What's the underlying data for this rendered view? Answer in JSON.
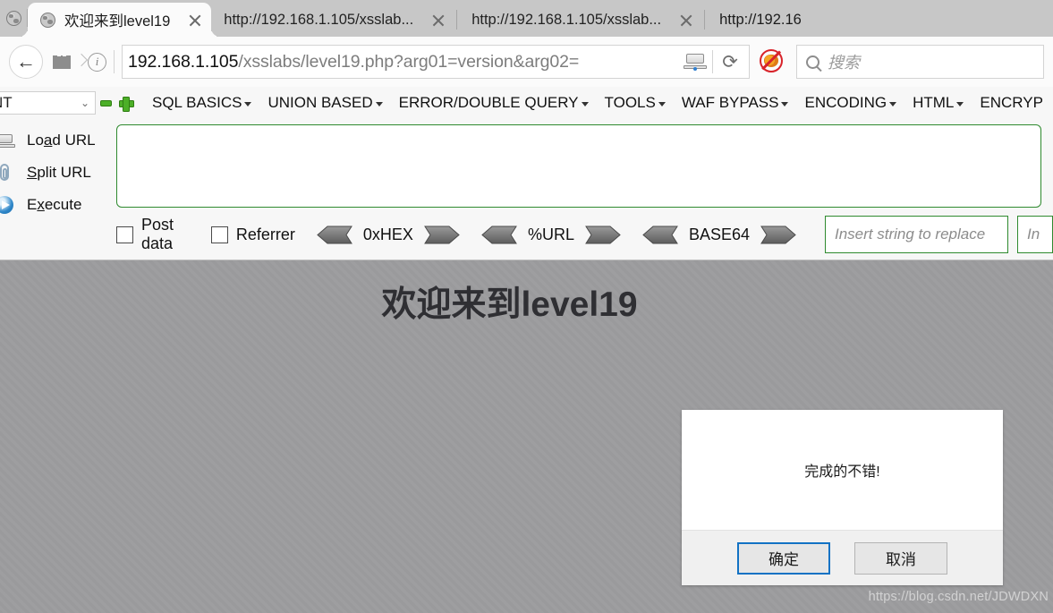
{
  "browser": {
    "tabs": [
      {
        "title": "欢迎来到level19",
        "favicon": "globe-icon",
        "active": true
      },
      {
        "title": "http://192.168.1.105/xsslab...",
        "favicon": "globe-icon",
        "active": false
      },
      {
        "title": "http://192.168.1.105/xsslab...",
        "favicon": "globe-icon",
        "active": false
      },
      {
        "title": "http://192.16",
        "favicon": "globe-icon",
        "active": false
      }
    ],
    "nav": {
      "back_icon": "back-arrow-icon",
      "back_glyph": "←",
      "library_icon": "library-icon",
      "forward_chevron_icon": "chevron-right-icon",
      "info_icon": "info-circle-icon",
      "info_glyph": "i"
    },
    "url": {
      "host": "192.168.1.105",
      "path": "/xsslabs/level19.php?arg01=version&arg02=",
      "full": "192.168.1.105/xsslabs/level19.php?arg01=version&arg02=",
      "save_icon": "save-to-device-icon",
      "reload_icon": "reload-icon",
      "reload_glyph": "⟳",
      "noscript_icon": "noscript-blocked-icon"
    },
    "search": {
      "placeholder": "搜索",
      "icon": "search-icon"
    }
  },
  "hackbar": {
    "select": {
      "value": "NT",
      "chevron": "chevron-down-icon",
      "glyph": "⌄"
    },
    "remove_icon": "minus-icon",
    "add_icon": "plus-icon",
    "menu": [
      {
        "label": "SQL BASICS",
        "has_caret": true
      },
      {
        "label": "UNION BASED",
        "has_caret": true
      },
      {
        "label": "ERROR/DOUBLE QUERY",
        "has_caret": true
      },
      {
        "label": "TOOLS",
        "has_caret": true
      },
      {
        "label": "WAF BYPASS",
        "has_caret": true
      },
      {
        "label": "ENCODING",
        "has_caret": true
      },
      {
        "label": "HTML",
        "has_caret": true
      },
      {
        "label": "ENCRYP",
        "has_caret": false
      }
    ],
    "actions": [
      {
        "label": "Load URL",
        "pre": "Lo",
        "key": "a",
        "post": "d URL",
        "icon": "load-url-icon"
      },
      {
        "label": "Split URL",
        "pre": "",
        "key": "S",
        "post": "plit URL",
        "icon": "split-url-icon"
      },
      {
        "label": "Execute",
        "pre": "E",
        "key": "x",
        "post": "ecute",
        "icon": "execute-icon"
      }
    ],
    "textarea_value": "",
    "checkboxes": [
      {
        "label": "Post data",
        "checked": false
      },
      {
        "label": "Referrer",
        "checked": false
      }
    ],
    "converters": [
      {
        "label": "0xHEX"
      },
      {
        "label": "%URL"
      },
      {
        "label": "BASE64"
      }
    ],
    "replace_fields": [
      {
        "placeholder": "Insert string to replace",
        "value": ""
      },
      {
        "placeholder": "In",
        "value": ""
      }
    ]
  },
  "page": {
    "title": "欢迎来到level19",
    "dialog": {
      "message": "完成的不错!",
      "confirm_label": "确定",
      "cancel_label": "取消"
    },
    "watermark": "https://blog.csdn.net/JDWDXN"
  }
}
